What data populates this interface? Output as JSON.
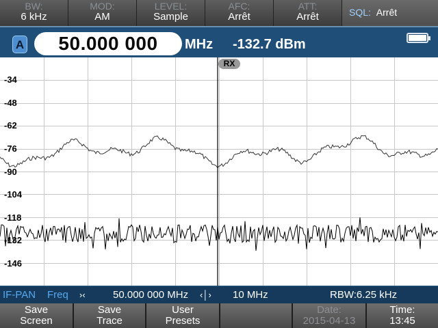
{
  "params": [
    {
      "label": "BW:",
      "value": "6 kHz"
    },
    {
      "label": "MOD:",
      "value": "AM"
    },
    {
      "label": "LEVEL:",
      "value": "Sample"
    },
    {
      "label": "AFC:",
      "value": "Arrêt"
    },
    {
      "label": "ATT:",
      "value": "Arrêt"
    }
  ],
  "sql": {
    "label": "SQL:",
    "value": "Arrêt"
  },
  "freq_row": {
    "channel": "A",
    "frequency": "50.000 000",
    "unit": "MHz",
    "level": "-132.7 dBm"
  },
  "battery": {
    "level": 1.0
  },
  "plot": {
    "marker": "RX",
    "y_ticks": [
      "-34",
      "-48",
      "-62",
      "-76",
      "-90",
      "-104",
      "-118",
      "-132",
      "-146"
    ],
    "y_range": [
      -160,
      -20
    ],
    "grid": true
  },
  "status": {
    "mode": "IF-PAN",
    "freq_label": "Freq",
    "center": "50.000 000 MHz",
    "span": "10 MHz",
    "rbw": "RBW:6.25 kHz"
  },
  "softkeys": [
    {
      "line1": "Save",
      "line2": "Screen",
      "enabled": true
    },
    {
      "line1": "Save",
      "line2": "Trace",
      "enabled": true
    },
    {
      "line1": "User",
      "line2": "Presets",
      "enabled": true
    },
    {
      "line1": "",
      "line2": "",
      "enabled": false
    },
    {
      "line1": "Date:",
      "line2": "2015-04-13",
      "enabled": false
    },
    {
      "line1": "Time:",
      "line2": "13:45",
      "enabled": true
    }
  ],
  "colors": {
    "freq_row_bg": "#1f4f78",
    "status_bg": "#163a5c",
    "status_accent": "#57a8f0",
    "status_text": "#ffffff",
    "sql_label": "#9fd0ff"
  }
}
